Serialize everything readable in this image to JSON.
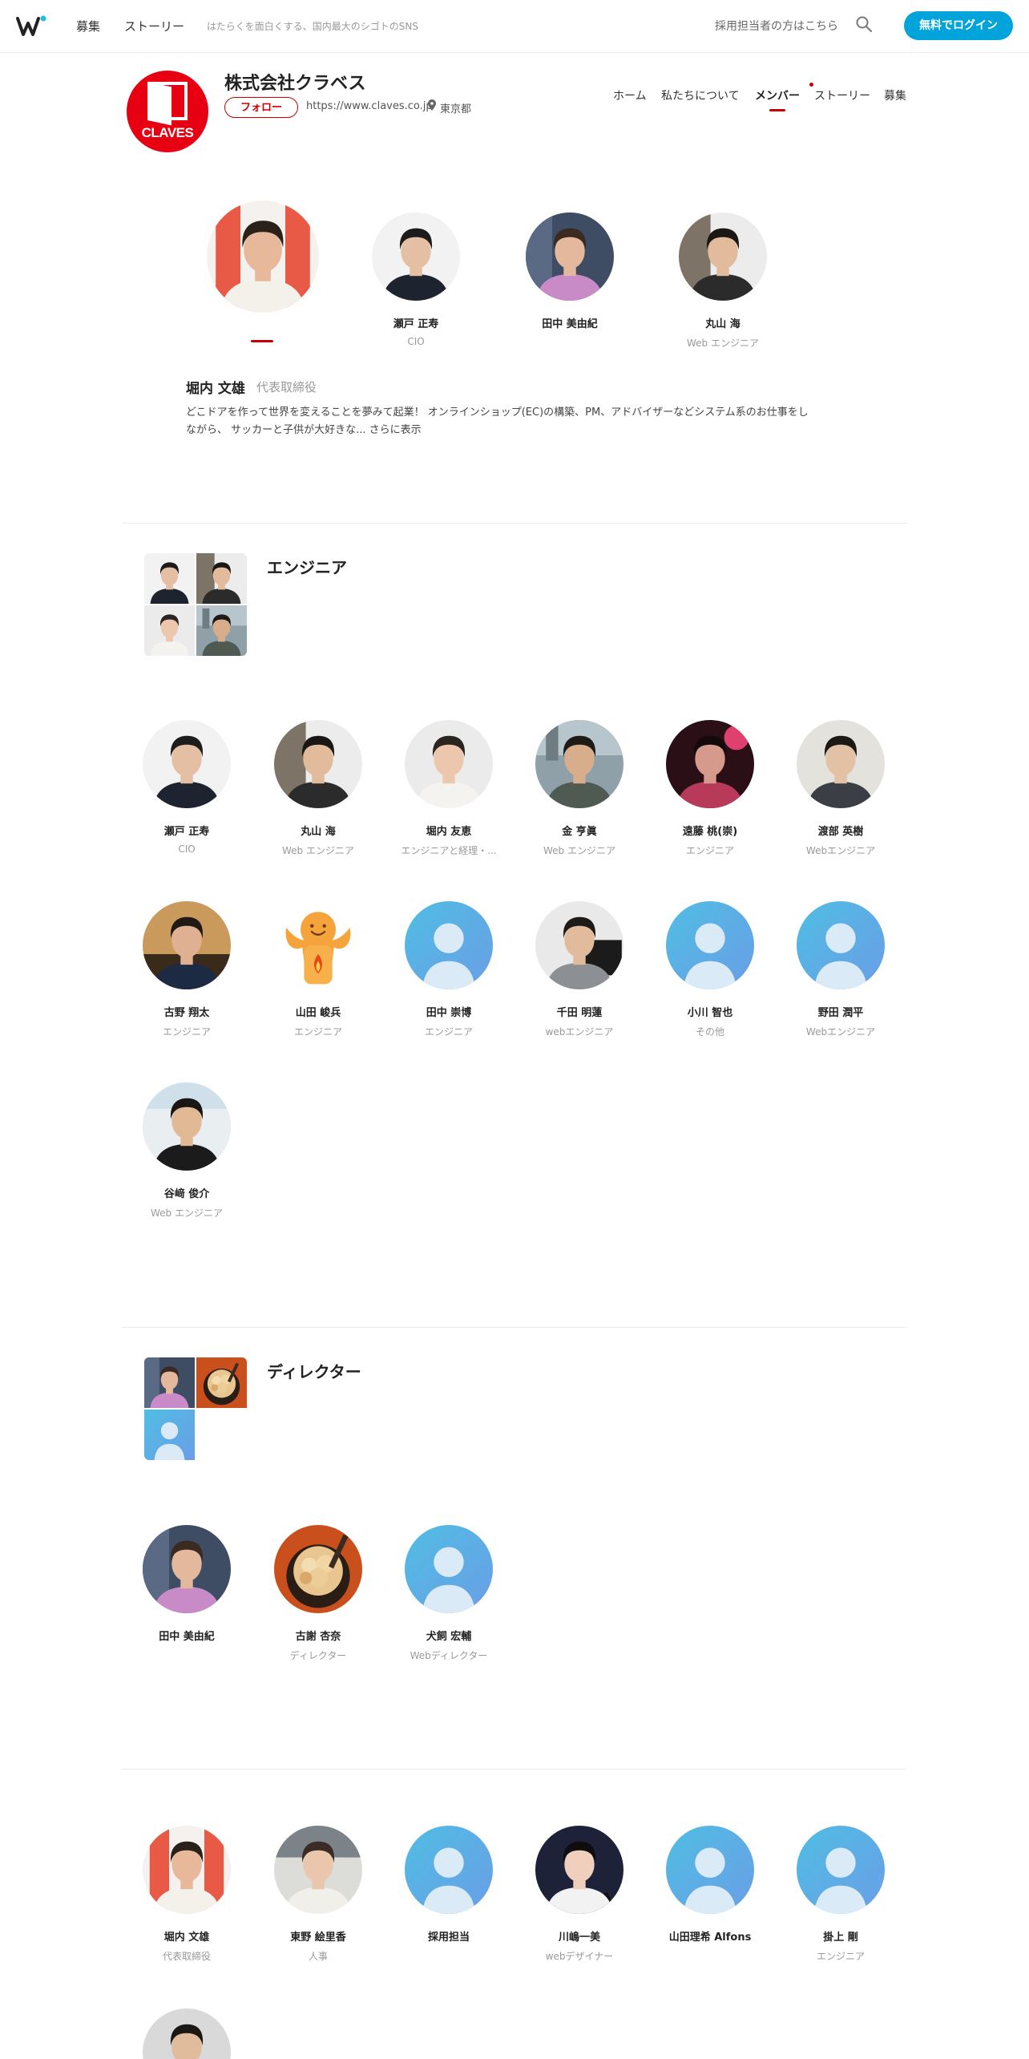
{
  "header": {
    "nav": [
      "募集",
      "ストーリー"
    ],
    "tagline": "はたらくを面白くする、国内最大のシゴトのSNS",
    "recruiter_link": "採用担当者の方はこちら",
    "login_label": "無料でログイン"
  },
  "company": {
    "logo_text": "CLAVES",
    "name": "株式会社クラベス",
    "follow_label": "フォロー",
    "url": "https://www.claves.co.jp",
    "location": "東京都",
    "nav": [
      "ホーム",
      "私たちについて",
      "メンバー",
      "ストーリー",
      "募集"
    ],
    "active_nav": "メンバー"
  },
  "featured": {
    "selected": {
      "name": "堀内 文雄",
      "role": "代表取締役",
      "bio": "どこドアを作って世界を変えることを夢みて起業！ オンラインショップ(EC)の構築、PM、アドバイザーなどシステム系のお仕事をしながら、 サッカーと子供が大好きな... さらに表示"
    },
    "members": [
      {
        "name": "瀬戸 正寿",
        "role": "CIO"
      },
      {
        "name": "田中 美由紀",
        "role": ""
      },
      {
        "name": "丸山 海",
        "role": "Web エンジニア"
      }
    ]
  },
  "groups": [
    {
      "title": "エンジニア",
      "members": [
        {
          "name": "瀬戸 正寿",
          "role": "CIO"
        },
        {
          "name": "丸山 海",
          "role": "Web エンジニア"
        },
        {
          "name": "堀内 友恵",
          "role": "エンジニアと経理・..."
        },
        {
          "name": "金 亨眞",
          "role": "Web エンジニア"
        },
        {
          "name": "遠藤 桃(崇)",
          "role": "エンジニア"
        },
        {
          "name": "渡部 英樹",
          "role": "Webエンジニア"
        },
        {
          "name": "古野 翔太",
          "role": "エンジニア"
        },
        {
          "name": "山田 峻兵",
          "role": "エンジニア"
        },
        {
          "name": "田中 崇博",
          "role": "エンジニア"
        },
        {
          "name": "千田 明蓮",
          "role": "webエンジニア"
        },
        {
          "name": "小川 智也",
          "role": "その他"
        },
        {
          "name": "野田 潤平",
          "role": "Webエンジニア"
        },
        {
          "name": "谷﨑 俊介",
          "role": "Web エンジニア"
        }
      ]
    },
    {
      "title": "ディレクター",
      "members": [
        {
          "name": "田中 美由紀",
          "role": ""
        },
        {
          "name": "古謝 杏奈",
          "role": "ディレクター"
        },
        {
          "name": "犬飼 宏輔",
          "role": "Webディレクター"
        }
      ]
    },
    {
      "title": "",
      "members": [
        {
          "name": "堀内 文雄",
          "role": "代表取締役"
        },
        {
          "name": "東野 絵里香",
          "role": "人事"
        },
        {
          "name": "採用担当",
          "role": ""
        },
        {
          "name": "川嶋一美",
          "role": "webデザイナー"
        },
        {
          "name": "山田理希 Alfons",
          "role": ""
        },
        {
          "name": "掛上 剛",
          "role": "エンジニア"
        }
      ]
    }
  ],
  "colors": {
    "brand_red": "#e60012",
    "accent_red": "#cc0000",
    "login_blue": "#00a4db",
    "placeholder_blue": "#5ab0e0"
  }
}
